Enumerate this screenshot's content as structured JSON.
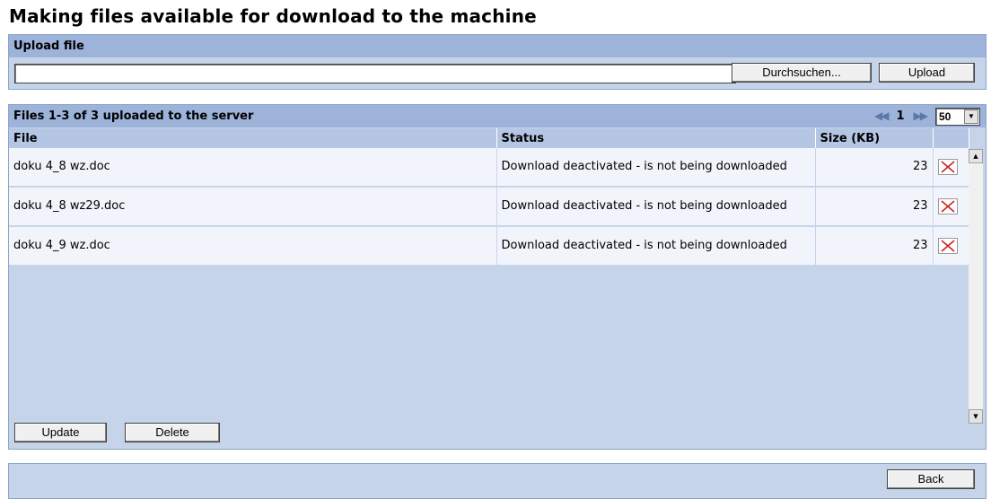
{
  "page": {
    "title": "Making files available for download to the machine"
  },
  "upload": {
    "header": "Upload file",
    "file_value": "",
    "browse_label": "Durchsuchen...",
    "upload_label": "Upload"
  },
  "files": {
    "header": "Files 1-3 of 3 uploaded to the server",
    "pager": {
      "current_page": "1",
      "page_size": "50",
      "first_icon": "double-left-arrow-icon",
      "next_icon": "double-right-arrow-icon"
    },
    "columns": {
      "file": "File",
      "status": "Status",
      "size": "Size (KB)"
    },
    "rows": [
      {
        "file": "doku 4_8 wz.doc",
        "status": "Download deactivated - is not being downloaded",
        "size": "23"
      },
      {
        "file": "doku 4_8 wz29.doc",
        "status": "Download deactivated - is not being downloaded",
        "size": "23"
      },
      {
        "file": "doku 4_9 wz.doc",
        "status": "Download deactivated - is not being downloaded",
        "size": "23"
      }
    ],
    "update_label": "Update",
    "delete_label": "Delete"
  },
  "footer": {
    "back_label": "Back"
  },
  "colors": {
    "panel_bg": "#c6d4ea",
    "header_bg": "#9db3da",
    "row_bg": "#f1f5fb",
    "delete_icon": "#cc2222"
  }
}
